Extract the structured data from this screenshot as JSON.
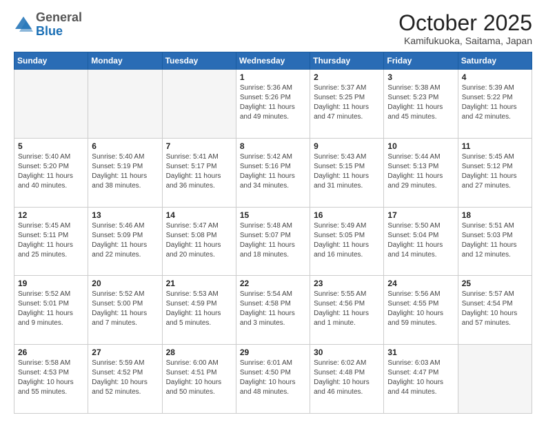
{
  "header": {
    "logo_general": "General",
    "logo_blue": "Blue",
    "month": "October 2025",
    "location": "Kamifukuoka, Saitama, Japan"
  },
  "weekdays": [
    "Sunday",
    "Monday",
    "Tuesday",
    "Wednesday",
    "Thursday",
    "Friday",
    "Saturday"
  ],
  "weeks": [
    [
      {
        "day": "",
        "empty": true
      },
      {
        "day": "",
        "empty": true
      },
      {
        "day": "",
        "empty": true
      },
      {
        "day": "1",
        "sunrise": "Sunrise: 5:36 AM",
        "sunset": "Sunset: 5:26 PM",
        "daylight": "Daylight: 11 hours and 49 minutes."
      },
      {
        "day": "2",
        "sunrise": "Sunrise: 5:37 AM",
        "sunset": "Sunset: 5:25 PM",
        "daylight": "Daylight: 11 hours and 47 minutes."
      },
      {
        "day": "3",
        "sunrise": "Sunrise: 5:38 AM",
        "sunset": "Sunset: 5:23 PM",
        "daylight": "Daylight: 11 hours and 45 minutes."
      },
      {
        "day": "4",
        "sunrise": "Sunrise: 5:39 AM",
        "sunset": "Sunset: 5:22 PM",
        "daylight": "Daylight: 11 hours and 42 minutes."
      }
    ],
    [
      {
        "day": "5",
        "sunrise": "Sunrise: 5:40 AM",
        "sunset": "Sunset: 5:20 PM",
        "daylight": "Daylight: 11 hours and 40 minutes."
      },
      {
        "day": "6",
        "sunrise": "Sunrise: 5:40 AM",
        "sunset": "Sunset: 5:19 PM",
        "daylight": "Daylight: 11 hours and 38 minutes."
      },
      {
        "day": "7",
        "sunrise": "Sunrise: 5:41 AM",
        "sunset": "Sunset: 5:17 PM",
        "daylight": "Daylight: 11 hours and 36 minutes."
      },
      {
        "day": "8",
        "sunrise": "Sunrise: 5:42 AM",
        "sunset": "Sunset: 5:16 PM",
        "daylight": "Daylight: 11 hours and 34 minutes."
      },
      {
        "day": "9",
        "sunrise": "Sunrise: 5:43 AM",
        "sunset": "Sunset: 5:15 PM",
        "daylight": "Daylight: 11 hours and 31 minutes."
      },
      {
        "day": "10",
        "sunrise": "Sunrise: 5:44 AM",
        "sunset": "Sunset: 5:13 PM",
        "daylight": "Daylight: 11 hours and 29 minutes."
      },
      {
        "day": "11",
        "sunrise": "Sunrise: 5:45 AM",
        "sunset": "Sunset: 5:12 PM",
        "daylight": "Daylight: 11 hours and 27 minutes."
      }
    ],
    [
      {
        "day": "12",
        "sunrise": "Sunrise: 5:45 AM",
        "sunset": "Sunset: 5:11 PM",
        "daylight": "Daylight: 11 hours and 25 minutes."
      },
      {
        "day": "13",
        "sunrise": "Sunrise: 5:46 AM",
        "sunset": "Sunset: 5:09 PM",
        "daylight": "Daylight: 11 hours and 22 minutes."
      },
      {
        "day": "14",
        "sunrise": "Sunrise: 5:47 AM",
        "sunset": "Sunset: 5:08 PM",
        "daylight": "Daylight: 11 hours and 20 minutes."
      },
      {
        "day": "15",
        "sunrise": "Sunrise: 5:48 AM",
        "sunset": "Sunset: 5:07 PM",
        "daylight": "Daylight: 11 hours and 18 minutes."
      },
      {
        "day": "16",
        "sunrise": "Sunrise: 5:49 AM",
        "sunset": "Sunset: 5:05 PM",
        "daylight": "Daylight: 11 hours and 16 minutes."
      },
      {
        "day": "17",
        "sunrise": "Sunrise: 5:50 AM",
        "sunset": "Sunset: 5:04 PM",
        "daylight": "Daylight: 11 hours and 14 minutes."
      },
      {
        "day": "18",
        "sunrise": "Sunrise: 5:51 AM",
        "sunset": "Sunset: 5:03 PM",
        "daylight": "Daylight: 11 hours and 12 minutes."
      }
    ],
    [
      {
        "day": "19",
        "sunrise": "Sunrise: 5:52 AM",
        "sunset": "Sunset: 5:01 PM",
        "daylight": "Daylight: 11 hours and 9 minutes."
      },
      {
        "day": "20",
        "sunrise": "Sunrise: 5:52 AM",
        "sunset": "Sunset: 5:00 PM",
        "daylight": "Daylight: 11 hours and 7 minutes."
      },
      {
        "day": "21",
        "sunrise": "Sunrise: 5:53 AM",
        "sunset": "Sunset: 4:59 PM",
        "daylight": "Daylight: 11 hours and 5 minutes."
      },
      {
        "day": "22",
        "sunrise": "Sunrise: 5:54 AM",
        "sunset": "Sunset: 4:58 PM",
        "daylight": "Daylight: 11 hours and 3 minutes."
      },
      {
        "day": "23",
        "sunrise": "Sunrise: 5:55 AM",
        "sunset": "Sunset: 4:56 PM",
        "daylight": "Daylight: 11 hours and 1 minute."
      },
      {
        "day": "24",
        "sunrise": "Sunrise: 5:56 AM",
        "sunset": "Sunset: 4:55 PM",
        "daylight": "Daylight: 10 hours and 59 minutes."
      },
      {
        "day": "25",
        "sunrise": "Sunrise: 5:57 AM",
        "sunset": "Sunset: 4:54 PM",
        "daylight": "Daylight: 10 hours and 57 minutes."
      }
    ],
    [
      {
        "day": "26",
        "sunrise": "Sunrise: 5:58 AM",
        "sunset": "Sunset: 4:53 PM",
        "daylight": "Daylight: 10 hours and 55 minutes."
      },
      {
        "day": "27",
        "sunrise": "Sunrise: 5:59 AM",
        "sunset": "Sunset: 4:52 PM",
        "daylight": "Daylight: 10 hours and 52 minutes."
      },
      {
        "day": "28",
        "sunrise": "Sunrise: 6:00 AM",
        "sunset": "Sunset: 4:51 PM",
        "daylight": "Daylight: 10 hours and 50 minutes."
      },
      {
        "day": "29",
        "sunrise": "Sunrise: 6:01 AM",
        "sunset": "Sunset: 4:50 PM",
        "daylight": "Daylight: 10 hours and 48 minutes."
      },
      {
        "day": "30",
        "sunrise": "Sunrise: 6:02 AM",
        "sunset": "Sunset: 4:48 PM",
        "daylight": "Daylight: 10 hours and 46 minutes."
      },
      {
        "day": "31",
        "sunrise": "Sunrise: 6:03 AM",
        "sunset": "Sunset: 4:47 PM",
        "daylight": "Daylight: 10 hours and 44 minutes."
      },
      {
        "day": "",
        "empty": true
      }
    ]
  ]
}
